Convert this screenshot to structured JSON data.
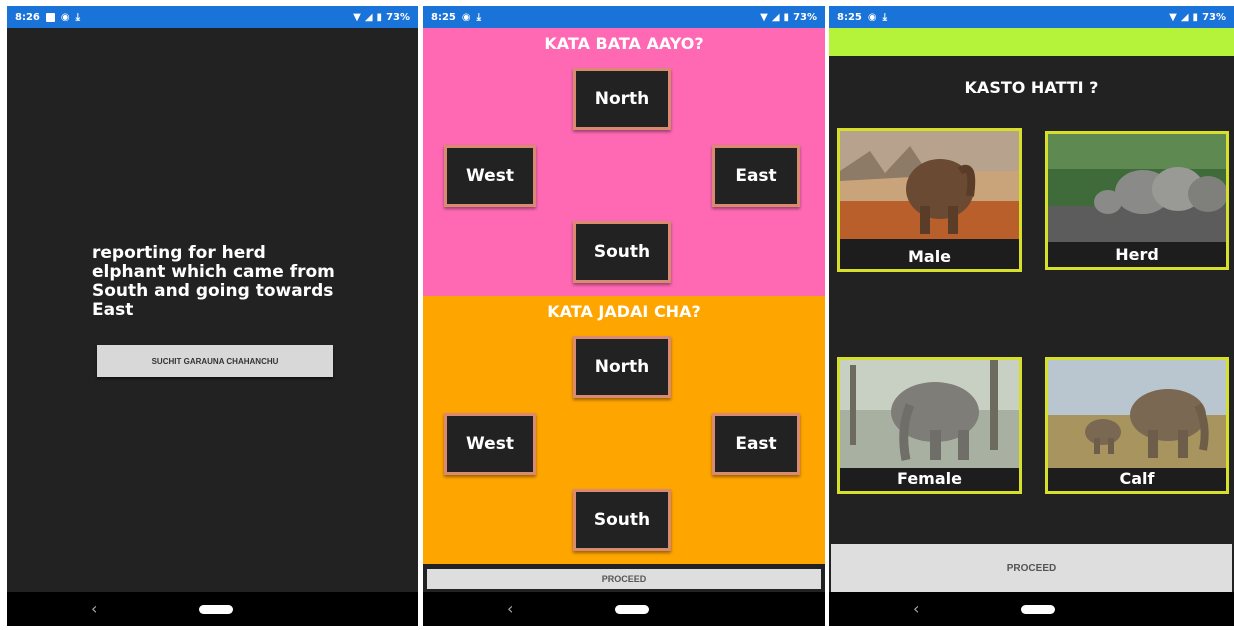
{
  "status": {
    "s1_time": "8:26",
    "s2_time": "8:25",
    "s3_time": "8:25",
    "battery": "73%"
  },
  "screen1": {
    "report_text": "reporting for herd elphant which came from South and going towards East",
    "button_label": "SUCHIT GARAUNA CHAHANCHU"
  },
  "screen2": {
    "from_question": "KATA BATA AAYO?",
    "to_question": "KATA JADAI CHA?",
    "directions": {
      "north": "North",
      "west": "West",
      "east": "East",
      "south": "South"
    },
    "proceed_label": "PROCEED"
  },
  "screen3": {
    "question": "KASTO HATTI ?",
    "options": {
      "male": "Male",
      "herd": "Herd",
      "female": "Female",
      "calf": "Calf"
    },
    "proceed_label": "PROCEED"
  },
  "colors": {
    "status_bar": "#1a73d9",
    "from_bg": "#ff69b4",
    "to_bg": "#ffa500",
    "accent_green": "#b5f23a",
    "card_border": "#d6e02a"
  },
  "icons": [
    "notification-icon",
    "sync-icon",
    "download-icon",
    "wifi-icon",
    "signal-icon",
    "battery-icon",
    "back-icon",
    "home-icon"
  ]
}
